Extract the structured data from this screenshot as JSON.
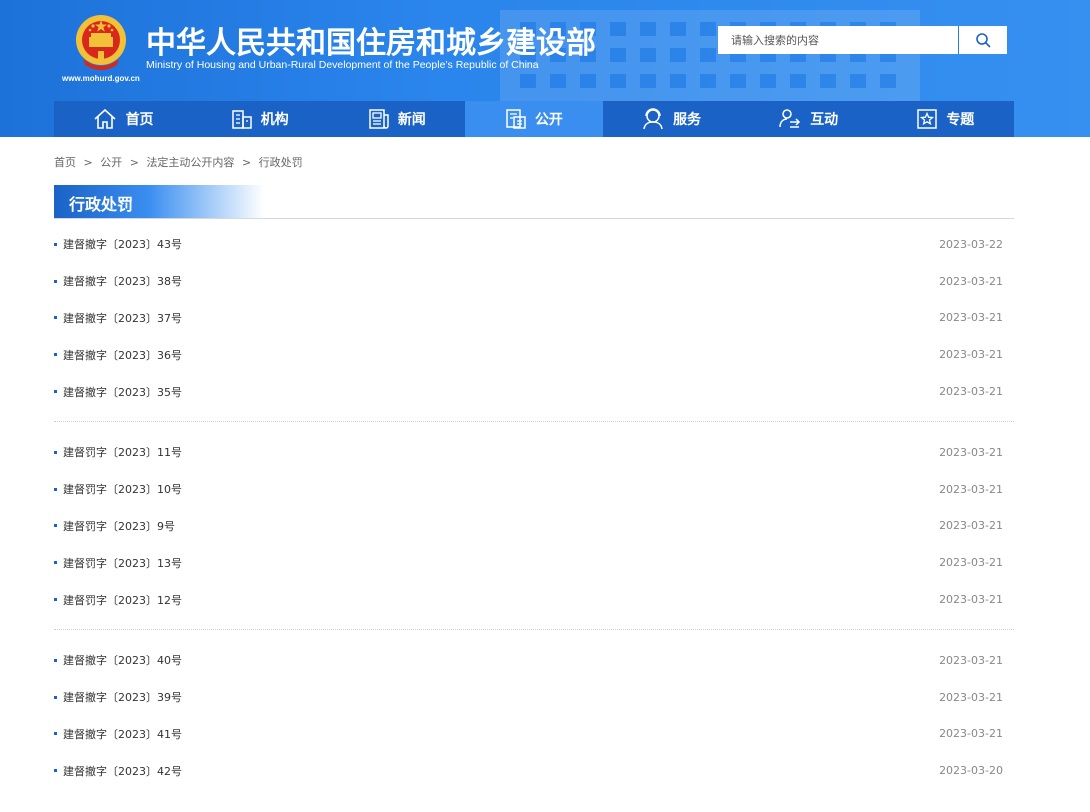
{
  "header": {
    "title_cn": "中华人民共和国住房和城乡建设部",
    "title_en": "Ministry of Housing and Urban-Rural Development of the People’s Republic of China",
    "site_url": "www.mohurd.gov.cn",
    "search_placeholder": "请输入搜索的内容",
    "search_icon": "search-icon"
  },
  "nav": [
    {
      "label": "首页",
      "icon": "home-icon",
      "active": false
    },
    {
      "label": "机构",
      "icon": "building-icon",
      "active": false
    },
    {
      "label": "新闻",
      "icon": "news-icon",
      "active": false
    },
    {
      "label": "公开",
      "icon": "documents-icon",
      "active": true
    },
    {
      "label": "服务",
      "icon": "service-icon",
      "active": false
    },
    {
      "label": "互动",
      "icon": "interaction-icon",
      "active": false
    },
    {
      "label": "专题",
      "icon": "star-icon",
      "active": false
    }
  ],
  "breadcrumb": {
    "items": [
      "首页",
      "公开",
      "法定主动公开内容",
      "行政处罚"
    ],
    "separator": ">"
  },
  "section": {
    "title": "行政处罚"
  },
  "colors": {
    "header_blue": "#2a85ec",
    "nav_blue": "#1a62c6",
    "nav_active": "#3a8ef0"
  },
  "groups": [
    [
      {
        "title": "建督撤字〔2023〕43号",
        "date": "2023-03-22"
      },
      {
        "title": "建督撤字〔2023〕38号",
        "date": "2023-03-21"
      },
      {
        "title": "建督撤字〔2023〕37号",
        "date": "2023-03-21"
      },
      {
        "title": "建督撤字〔2023〕36号",
        "date": "2023-03-21"
      },
      {
        "title": "建督撤字〔2023〕35号",
        "date": "2023-03-21"
      }
    ],
    [
      {
        "title": "建督罚字〔2023〕11号",
        "date": "2023-03-21"
      },
      {
        "title": "建督罚字〔2023〕10号",
        "date": "2023-03-21"
      },
      {
        "title": "建督罚字〔2023〕9号",
        "date": "2023-03-21"
      },
      {
        "title": "建督罚字〔2023〕13号",
        "date": "2023-03-21"
      },
      {
        "title": "建督罚字〔2023〕12号",
        "date": "2023-03-21"
      }
    ],
    [
      {
        "title": "建督撤字〔2023〕40号",
        "date": "2023-03-21"
      },
      {
        "title": "建督撤字〔2023〕39号",
        "date": "2023-03-21"
      },
      {
        "title": "建督撤字〔2023〕41号",
        "date": "2023-03-21"
      },
      {
        "title": "建督撤字〔2023〕42号",
        "date": "2023-03-20"
      }
    ]
  ]
}
